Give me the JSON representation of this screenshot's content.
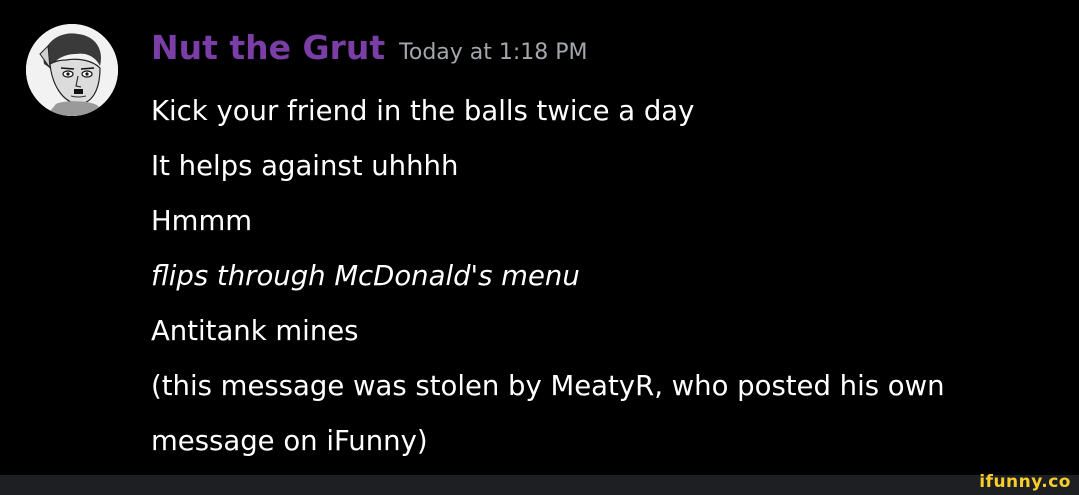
{
  "message": {
    "username": "Nut the Grut",
    "timestamp": "Today at 1:18 PM",
    "lines": [
      "Kick your friend in the balls twice a day",
      "It helps against uhhhh",
      "Hmmm",
      "flips through McDonald's menu",
      "Antitank mines",
      "(this message was stolen by MeatyR, who posted his own",
      "message on iFunny)"
    ],
    "italic_line_index": 3
  },
  "avatar": {
    "icon": "user-avatar-drawing"
  },
  "watermark": {
    "text": "ifunny.co"
  },
  "colors": {
    "background": "#000000",
    "username": "#7a3ea6",
    "timestamp": "#a3a6aa",
    "text": "#ffffff",
    "watermark": "#f7ce2b"
  }
}
